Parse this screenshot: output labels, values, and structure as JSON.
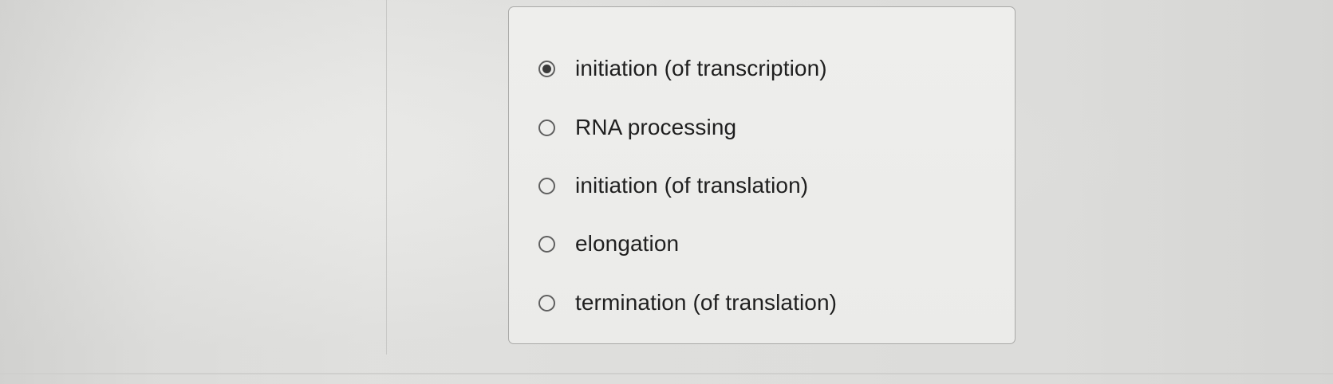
{
  "question": {
    "options": [
      {
        "label": "initiation (of transcription)",
        "selected": true
      },
      {
        "label": "RNA processing",
        "selected": false
      },
      {
        "label": "initiation (of translation)",
        "selected": false
      },
      {
        "label": "elongation",
        "selected": false
      },
      {
        "label": "termination (of translation)",
        "selected": false
      }
    ]
  }
}
